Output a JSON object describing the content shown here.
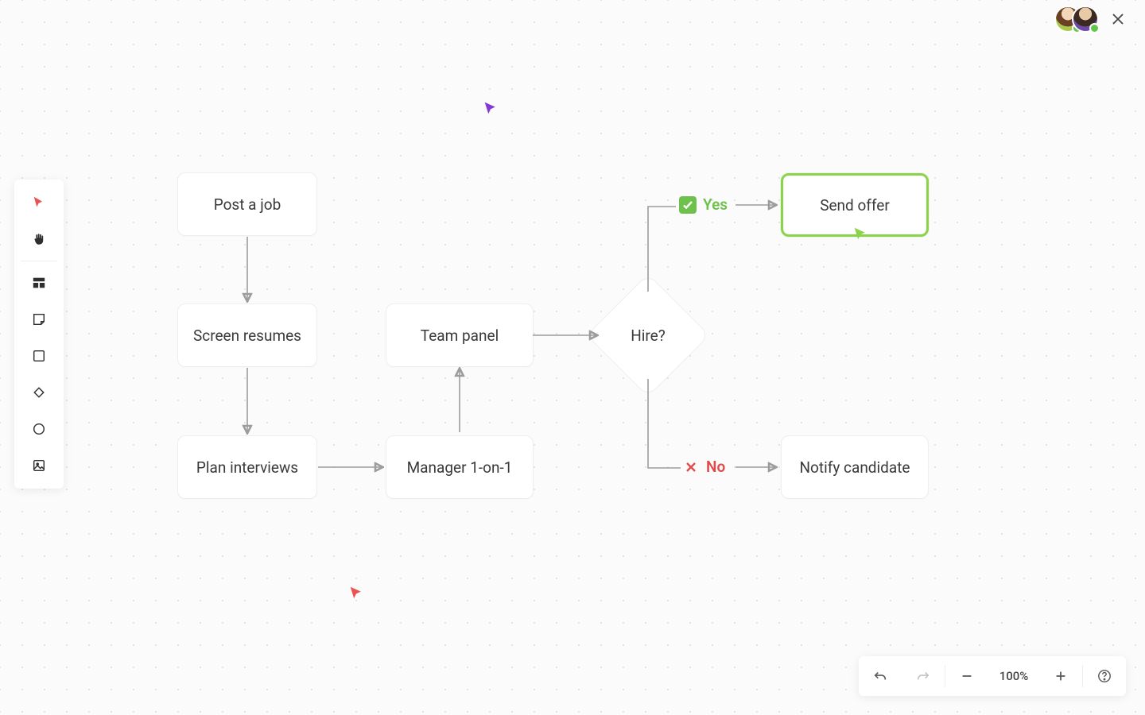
{
  "zoom": {
    "value": "100%"
  },
  "diagram": {
    "nodes": {
      "post_job": "Post a job",
      "screen_resumes": "Screen resumes",
      "plan_interviews": "Plan interviews",
      "manager_1on1": "Manager 1-on-1",
      "team_panel": "Team panel",
      "hire_decision": "Hire?",
      "send_offer": "Send offer",
      "notify_candidate": "Notify candidate"
    },
    "branches": {
      "yes": "Yes",
      "no": "No"
    }
  },
  "tools": {
    "pointer": "pointer-tool",
    "pan": "pan-tool",
    "template": "template-tool",
    "sticky": "sticky-note-tool",
    "rectangle": "rectangle-tool",
    "diamond": "diamond-tool",
    "circle": "circle-tool",
    "image": "image-tool"
  },
  "cursors": {
    "purple": "#8339d1",
    "green": "#8bd34a",
    "red": "#eb5252"
  }
}
